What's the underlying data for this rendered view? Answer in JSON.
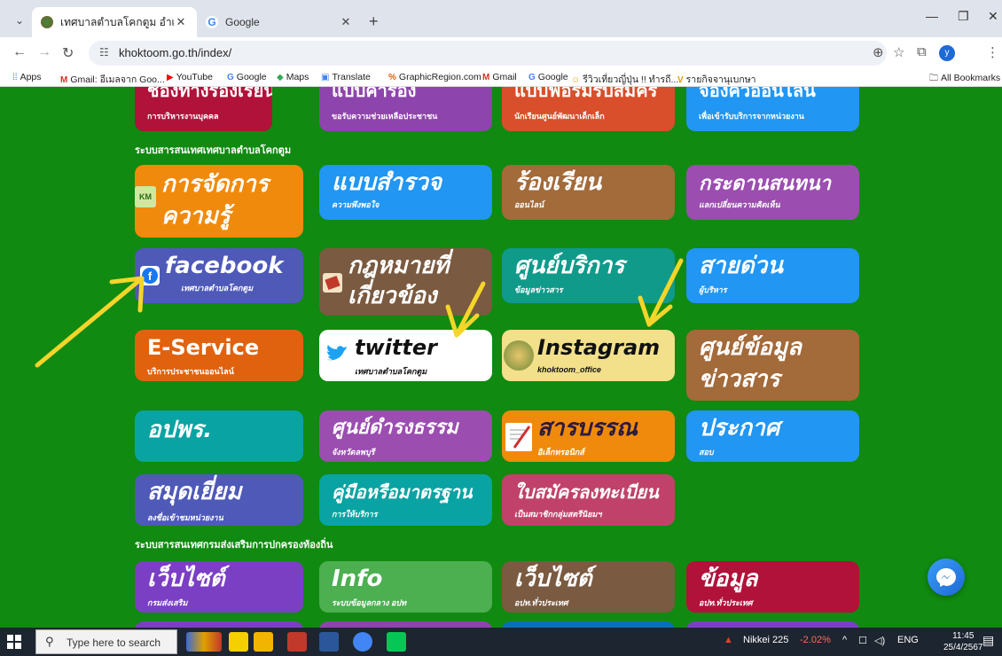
{
  "browser": {
    "tabs": [
      {
        "title": "เทศบาลตำบลโคกตูม อำเภอเมืองลพบ",
        "active": true
      },
      {
        "title": "Google",
        "active": false
      }
    ],
    "url": "khoktoom.go.th/index/",
    "bookmarks": [
      {
        "label": "Apps",
        "icon": "grid-icon"
      },
      {
        "label": "Gmail: อีเมลจาก Goo...",
        "icon": "gmail-icon"
      },
      {
        "label": "YouTube",
        "icon": "youtube-icon"
      },
      {
        "label": "Google",
        "icon": "google-icon"
      },
      {
        "label": "Maps",
        "icon": "maps-icon"
      },
      {
        "label": "Translate",
        "icon": "translate-icon"
      },
      {
        "label": "GraphicRegion.com",
        "icon": "graphicregion-icon"
      },
      {
        "label": "Gmail",
        "icon": "gmail-icon"
      },
      {
        "label": "Google",
        "icon": "google-icon"
      },
      {
        "label": "รีวิวเที่ยวญี่ปุ่น !! ทำรถี....",
        "icon": "smiley-icon"
      },
      {
        "label": "รายกิจจานุเบกษา",
        "icon": "v-icon"
      }
    ],
    "all_bookmarks": "All Bookmarks",
    "profile_initial": "y"
  },
  "page": {
    "top_row": [
      {
        "title": "ช่องทางร้องเรียน",
        "subtitle": "การบริหารงานบุคคล",
        "color": "#b0123a"
      },
      {
        "title": "แบบคำร้อง",
        "subtitle": "ขอรับความช่วยเหลือประชาชน",
        "color": "#8e44ad"
      },
      {
        "title": "แบบฟอร์มรับสมัคร",
        "subtitle": "นักเรียนศูนย์พัฒนาเด็กเล็ก",
        "color": "#d94e2b"
      },
      {
        "title": "จองคิวออนไลน์",
        "subtitle": "เพื่อเข้ารับบริการจากหน่วยงาน",
        "color": "#2196f3"
      }
    ],
    "section1_title": "ระบบสารสนเทศเทศบาลตำบลโคกตูม",
    "row1": [
      {
        "title": "การจัดการ",
        "title2": "ความรู้",
        "subtitle": "",
        "badge": "KM",
        "color": "#f08a0c"
      },
      {
        "title": "แบบสำรวจ",
        "subtitle": "ความพึงพอใจ",
        "color": "#2196f3"
      },
      {
        "title": "ร้องเรียน",
        "subtitle": "ออนไลน์",
        "color": "#a36a3a"
      },
      {
        "title": "กระดานสนทนา",
        "subtitle": "แลกเปลี่ยนความคิดเห็น",
        "color": "#9b4db0"
      }
    ],
    "row2": [
      {
        "title": "facebook",
        "subtitle": "เทศบาลตำบลโคกตูม",
        "color": "#4e59b8"
      },
      {
        "title": "กฎหมายที่",
        "title2": "เกี่ยวข้อง",
        "subtitle": "",
        "color": "#7a5a40"
      },
      {
        "title": "ศูนย์บริการ",
        "subtitle": "ข้อมูลข่าวสาร",
        "color": "#0f9a8a"
      },
      {
        "title": "สายด่วน",
        "subtitle": "ผู้บริหาร",
        "color": "#2196f3"
      }
    ],
    "row3": [
      {
        "title": "E-Service",
        "subtitle": "บริการประชาชนออนไลน์",
        "color": "#e0620e"
      },
      {
        "title": "twitter",
        "subtitle": "เทศบาลตำบลโคกตูม",
        "color": "#ffffff"
      },
      {
        "title": "Instagram",
        "subtitle": "khoktoom_office",
        "color": "#f2e08a"
      },
      {
        "title": "ศูนย์ข้อมูล",
        "title2": "ข่าวสาร",
        "subtitle": "",
        "color": "#a36a3a"
      }
    ],
    "row4": [
      {
        "title": "อปพร.",
        "subtitle": "",
        "color": "#0aa3a3"
      },
      {
        "title": "ศูนย์ดำรงธรรม",
        "subtitle": "จังหวัดลพบุรี",
        "color": "#9b4db0"
      },
      {
        "title": "สารบรรณ",
        "subtitle": "อิเล็กทรอนิกส์",
        "color": "#f08a0c"
      },
      {
        "title": "ประกาศ",
        "subtitle": "สอบ",
        "color": "#2196f3"
      }
    ],
    "row5": [
      {
        "title": "สมุดเยี่ยม",
        "subtitle": "ลงชื่อเข้าชมหน่วยงาน",
        "color": "#4e59b8"
      },
      {
        "title": "คู่มือหรือมาตรฐาน",
        "subtitle": "การให้บริการ",
        "color": "#0aa3a3"
      },
      {
        "title": "ใบสมัครลงทะเบียน",
        "subtitle": "เป็นสมาชิกกลุ่มสตรีนิยมฯ",
        "color": "#c0426a"
      }
    ],
    "section2_title": "ระบบสารสนเทศกรมส่งเสริมการปกครองท้องถิ่น",
    "row6": [
      {
        "title": "เว็บไซต์",
        "subtitle": "กรมส่งเสริม",
        "color": "#7b3fc4"
      },
      {
        "title": "Info",
        "subtitle": "ระบบข้อมูลกลาง อปท",
        "color": "#4caf50"
      },
      {
        "title": "เว็บไซต์",
        "subtitle": "อปท.ทั่วประเทศ",
        "color": "#7a5a40"
      },
      {
        "title": "ข้อมูล",
        "subtitle": "อปท.ทั่วประเทศ",
        "color": "#b0123a"
      }
    ]
  },
  "taskbar": {
    "search_placeholder": "Type here to search",
    "stock": "Nikkei 225",
    "stock_change": "-2.02%",
    "lang": "ENG",
    "time": "11:45",
    "date": "25/4/2567"
  }
}
